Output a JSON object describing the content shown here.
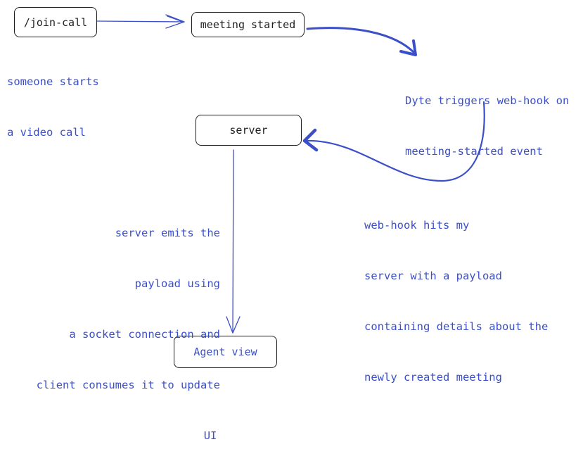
{
  "colors": {
    "accent": "#3b4fc8",
    "stroke": "#1e1e1e"
  },
  "nodes": {
    "join_call": "/join-call",
    "meeting_started": "meeting started",
    "server": "server",
    "agent_view": "Agent view"
  },
  "notes": {
    "someone_starts": [
      "someone starts",
      "a video call"
    ],
    "dyte_triggers": [
      "Dyte triggers web-hook on",
      "meeting-started event"
    ],
    "webhook_hits": [
      "web-hook hits my",
      "server with a payload",
      "containing details about the",
      "newly created meeting"
    ],
    "server_emits": [
      "server emits the",
      "payload using",
      "a socket connection and",
      "client consumes it to update",
      "UI"
    ]
  }
}
